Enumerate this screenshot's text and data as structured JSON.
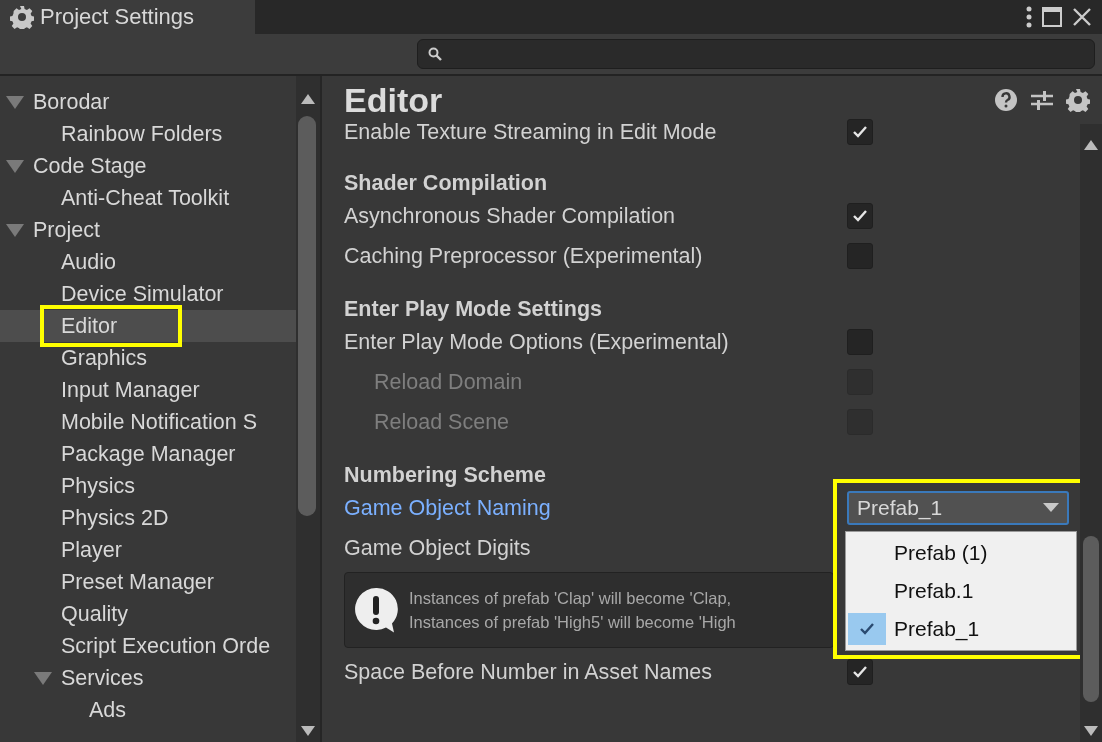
{
  "window": {
    "title": "Project Settings"
  },
  "sidebar": {
    "items": [
      {
        "label": "Borodar",
        "selected": false,
        "expanded": true,
        "children": [
          {
            "label": "Rainbow Folders",
            "selected": false
          }
        ]
      },
      {
        "label": "Code Stage",
        "selected": false,
        "expanded": true,
        "children": [
          {
            "label": "Anti-Cheat Toolkit",
            "selected": false
          }
        ]
      },
      {
        "label": "Project",
        "selected": false,
        "expanded": true,
        "children": [
          {
            "label": "Audio",
            "selected": false
          },
          {
            "label": "Device Simulator",
            "selected": false
          },
          {
            "label": "Editor",
            "selected": true,
            "highlighted": true
          },
          {
            "label": "Graphics",
            "selected": false
          },
          {
            "label": "Input Manager",
            "selected": false
          },
          {
            "label": "Mobile Notification S",
            "selected": false
          },
          {
            "label": "Package Manager",
            "selected": false
          },
          {
            "label": "Physics",
            "selected": false
          },
          {
            "label": "Physics 2D",
            "selected": false
          },
          {
            "label": "Player",
            "selected": false
          },
          {
            "label": "Preset Manager",
            "selected": false
          },
          {
            "label": "Quality",
            "selected": false
          },
          {
            "label": "Script Execution Orde",
            "selected": false
          },
          {
            "label": "Services",
            "selected": false,
            "expanded": true,
            "children": [
              {
                "label": "Ads",
                "selected": false
              }
            ]
          }
        ]
      }
    ]
  },
  "content": {
    "title": "Editor",
    "rows": [
      {
        "kind": "checkbox",
        "label": "Enable Texture Streaming in Edit Mode",
        "checked": true
      },
      {
        "kind": "heading",
        "label": "Shader Compilation"
      },
      {
        "kind": "checkbox",
        "label": "Asynchronous Shader Compilation",
        "checked": true
      },
      {
        "kind": "checkbox",
        "label": "Caching Preprocessor (Experimental)",
        "checked": false
      },
      {
        "kind": "heading",
        "label": "Enter Play Mode Settings"
      },
      {
        "kind": "checkbox",
        "label": "Enter Play Mode Options (Experimental)",
        "checked": false,
        "children": [
          {
            "kind": "checkbox",
            "label": "Reload Domain",
            "checked": false,
            "disabled": true
          },
          {
            "kind": "checkbox",
            "label": "Reload Scene",
            "checked": false,
            "disabled": true
          }
        ]
      },
      {
        "kind": "heading",
        "label": "Numbering Scheme"
      },
      {
        "kind": "dropdown",
        "label": "Game Object Naming",
        "focused": true,
        "value": "Prefab_1",
        "highlighted": true,
        "open": true,
        "options": [
          {
            "label": "Prefab (1)",
            "selected": false
          },
          {
            "label": "Prefab.1",
            "selected": false
          },
          {
            "label": "Prefab_1",
            "selected": true
          }
        ]
      },
      {
        "kind": "label",
        "label": "Game Object Digits"
      },
      {
        "kind": "help",
        "lines": [
          "Instances of prefab 'Clap' will become 'Clap,",
          "Instances of prefab 'High5' will become 'High"
        ]
      },
      {
        "kind": "checkbox",
        "label": "Space Before Number in Asset Names",
        "checked": true
      }
    ]
  }
}
